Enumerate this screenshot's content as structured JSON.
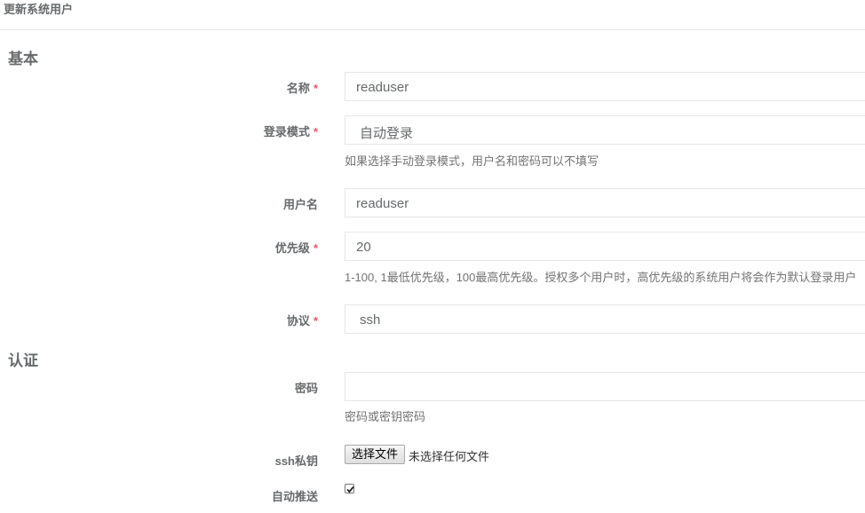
{
  "page": {
    "title": "更新系统用户"
  },
  "sections": {
    "basic": "基本",
    "auth": "认证"
  },
  "fields": {
    "name": {
      "label": "名称",
      "required": "*",
      "value": "readuser"
    },
    "login_mode": {
      "label": "登录模式",
      "required": "*",
      "value": "自动登录",
      "help": "如果选择手动登录模式，用户名和密码可以不填写"
    },
    "username": {
      "label": "用户名",
      "value": "readuser"
    },
    "priority": {
      "label": "优先级",
      "required": "*",
      "value": "20",
      "help": "1-100, 1最低优先级，100最高优先级。授权多个用户时，高优先级的系统用户将会作为默认登录用户"
    },
    "protocol": {
      "label": "协议",
      "required": "*",
      "value": "ssh"
    },
    "password": {
      "label": "密码",
      "value": "",
      "help": "密码或密钥密码"
    },
    "ssh_key": {
      "label": "ssh私钥",
      "button": "选择文件",
      "status": "未选择任何文件"
    },
    "auto_push": {
      "label": "自动推送",
      "checked": true
    }
  },
  "colors": {
    "required": "#ed5565",
    "border": "#e5e6e7",
    "text": "#676a6c"
  }
}
